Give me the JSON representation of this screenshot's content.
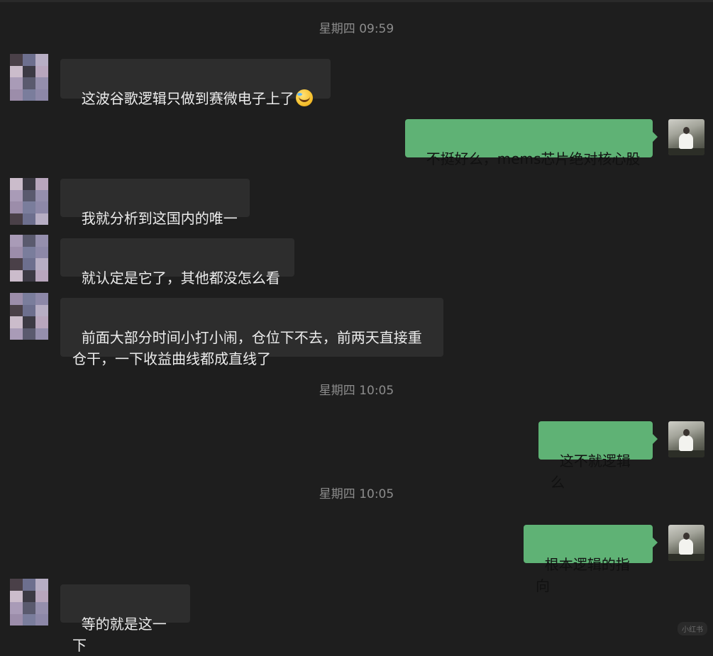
{
  "chat": {
    "timestamps": [
      "星期四 09:59",
      "星期四 10:05",
      "星期四 10:05"
    ],
    "messages": [
      {
        "side": "in",
        "text": "这波谷歌逻辑只做到赛微电子上了",
        "emoji": "laughing-crying-emoji"
      },
      {
        "side": "out",
        "text": "不挺好么，mems芯片绝对核心股"
      },
      {
        "side": "in",
        "text": "我就分析到这国内的唯一"
      },
      {
        "side": "in",
        "text": "就认定是它了，其他都没怎么看"
      },
      {
        "side": "in",
        "text": "前面大部分时间小打小闹，仓位下不去，前两天直接重\n仓干，一下收益曲线都成直线了"
      },
      {
        "side": "out",
        "text": "这不就逻辑么"
      },
      {
        "side": "out",
        "text": "根本逻辑的指向"
      },
      {
        "side": "in",
        "text": "等的就是这一下"
      }
    ]
  },
  "colors": {
    "background": "#1e1e1e",
    "incoming_bubble": "#2d2d2d",
    "outgoing_bubble": "#5fb275",
    "timestamp_text": "#8c8c8c"
  },
  "avatar_palette": [
    "#4a4048",
    "#b8a6bd",
    "#7a7d9c",
    "#cbbccb",
    "#958fad",
    "#6d6f8e",
    "#a99bb7",
    "#8d88a8",
    "#3c3a44",
    "#9c8daa",
    "#b7aec4",
    "#5a5a6e"
  ],
  "watermark": "小红书"
}
